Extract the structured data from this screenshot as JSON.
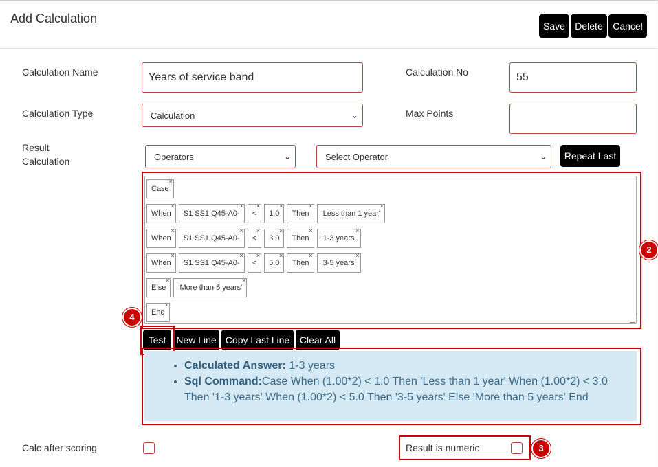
{
  "header": {
    "title": "Add Calculation",
    "save_label": "Save",
    "delete_label": "Delete",
    "cancel_label": "Cancel"
  },
  "form": {
    "calc_name_label": "Calculation Name",
    "calc_name_value": "Years of service band",
    "calc_no_label": "Calculation No",
    "calc_no_value": "55",
    "calc_type_label": "Calculation Type",
    "calc_type_value": "Calculation",
    "max_points_label": "Max Points",
    "max_points_value": "",
    "result_calc_label_1": "Result",
    "result_calc_label_2": "Calculation",
    "operators_value": "Operators",
    "select_operator_value": "Select Operator",
    "repeat_last_label": "Repeat Last"
  },
  "tokens": [
    [
      "Case"
    ],
    [
      "When",
      "S1 SS1 Q45-A0-",
      "<",
      "1.0",
      "Then",
      "'Less than 1 year'"
    ],
    [
      "When",
      "S1 SS1 Q45-A0-",
      "<",
      "3.0",
      "Then",
      "'1-3 years'"
    ],
    [
      "When",
      "S1 SS1 Q45-A0-",
      "<",
      "5.0",
      "Then",
      "'3-5 years'"
    ],
    [
      "Else",
      "'More than 5 years'"
    ],
    [
      "End"
    ]
  ],
  "token_close_glyph": "×",
  "actions": {
    "test_label": "Test",
    "new_line_label": "New Line",
    "copy_last_line_label": "Copy Last Line",
    "clear_all_label": "Clear All"
  },
  "result": {
    "answer_label": "Calculated Answer:",
    "answer_value": " 1-3 years",
    "sql_label": "Sql Command:",
    "sql_value": "Case When (1.00*2) < 1.0 Then 'Less than 1 year' When (1.00*2) < 3.0 Then '1-3 years' When (1.00*2) < 5.0 Then '3-5 years' Else 'More than 5 years' End"
  },
  "options": {
    "calc_after_scoring_label": "Calc after scoring",
    "result_numeric_label": "Result is numeric"
  },
  "badges": {
    "b2": "2",
    "b3": "3",
    "b4": "4"
  },
  "icons": {
    "chevron": "chevron-down-icon",
    "close": "close-icon"
  },
  "colors": {
    "accent_red": "#cc0000",
    "button_black": "#000000",
    "result_bg": "#d5e9f5"
  }
}
